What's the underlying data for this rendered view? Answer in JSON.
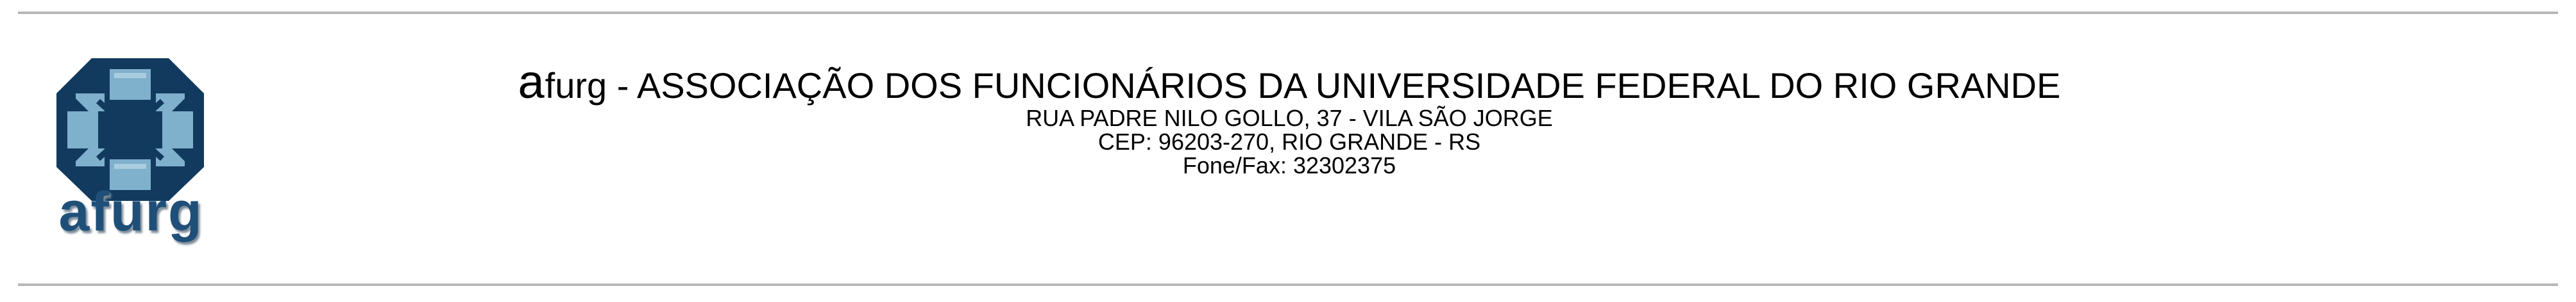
{
  "logo": {
    "wordmark": "afurg",
    "colors": {
      "outer": "#123a5e",
      "inner": "#7fb0cc",
      "wordmark": "#1f4f78"
    }
  },
  "header": {
    "title_prefix": "a",
    "title_rest": "furg - ASSOCIAÇÃO DOS FUNCIONÁRIOS DA UNIVERSIDADE FEDERAL DO RIO GRANDE",
    "address": "RUA PADRE NILO GOLLO, 37 - VILA SÃO JORGE",
    "cep": "CEP: 96203-270, RIO GRANDE - RS",
    "phone": "Fone/Fax: 32302375"
  },
  "colors": {
    "rule": "#b8b8b8"
  }
}
